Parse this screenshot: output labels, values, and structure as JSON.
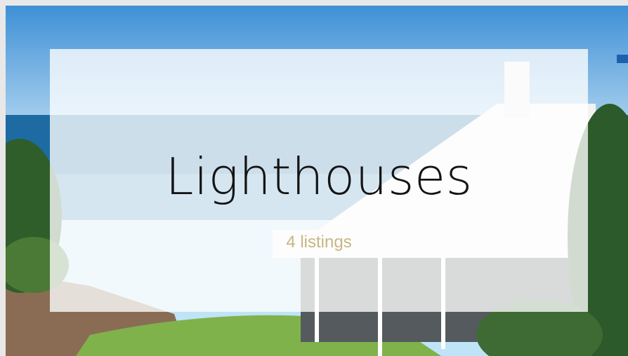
{
  "collection": {
    "title": "Lighthouses",
    "count_label": "4 listings"
  },
  "colors": {
    "sky": "#5aa0db",
    "sea": "#1c6aa0",
    "lawn": "#7fb24a",
    "overlay": "#ffffff",
    "title_text": "#141414",
    "count_text": "#c9b583"
  }
}
